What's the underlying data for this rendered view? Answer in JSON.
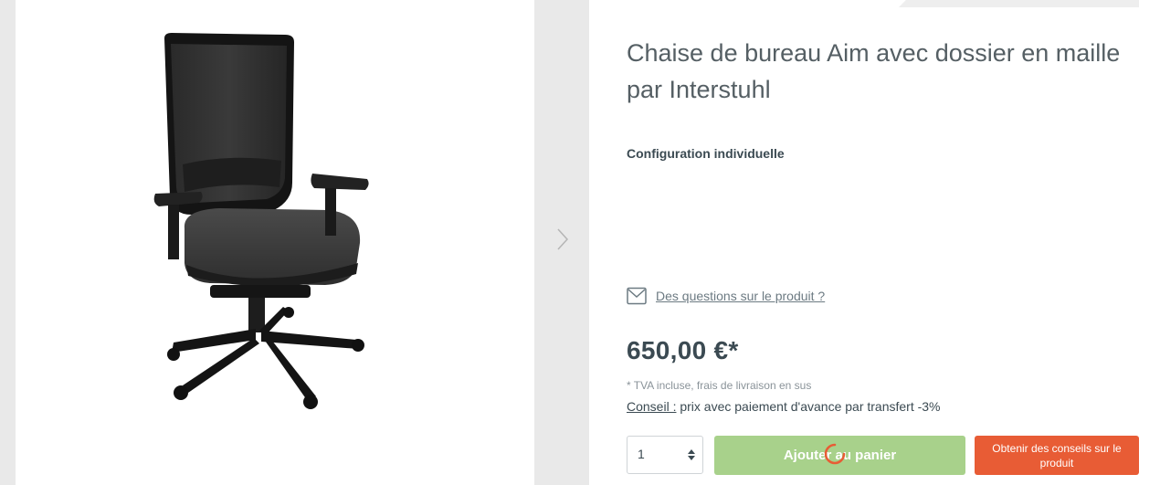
{
  "product": {
    "title": "Chaise de bureau Aim avec dossier en maille par Interstuhl",
    "configuration_label": "Configuration individuelle",
    "questions_link": "Des questions sur le produit ?",
    "price": "650,00 €*",
    "vat_note": "* TVA incluse, frais de livraison en sus",
    "advice_label": "Conseil :",
    "advice_text": " prix avec paiement d'avance par transfert -3%",
    "quantity": "1",
    "add_to_cart_label": "Ajouter au panier",
    "get_advice_label": "Obtenir des conseils sur le produit"
  },
  "icons": {
    "gallery_next": "chevron-right-icon",
    "questions": "envelope-icon",
    "loading": "spinner-icon",
    "quantity": "up-down-arrows-icon"
  },
  "colors": {
    "add_to_cart": "#a8d18b",
    "advice_button": "#e85c35",
    "spinner": "#e85c35",
    "text": "#3b4a52"
  }
}
